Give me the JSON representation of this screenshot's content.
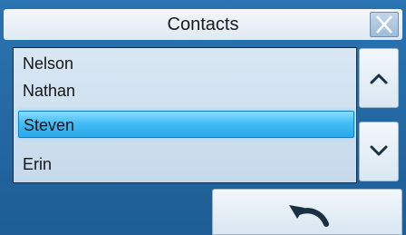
{
  "dialog": {
    "title": "Contacts"
  },
  "contacts": [
    "Nelson",
    "Nathan",
    "Steven",
    "Erin"
  ],
  "selected_contact": "Steven",
  "icons": {
    "close": "close-icon",
    "scroll_up": "chevron-up-icon",
    "scroll_down": "chevron-down-icon",
    "back": "undo-arrow-icon"
  },
  "colors": {
    "background": "#1f5f96",
    "list_background": "#d9e7f3",
    "selection": "#44bdf5",
    "title_bar": "#f4f8fb"
  }
}
